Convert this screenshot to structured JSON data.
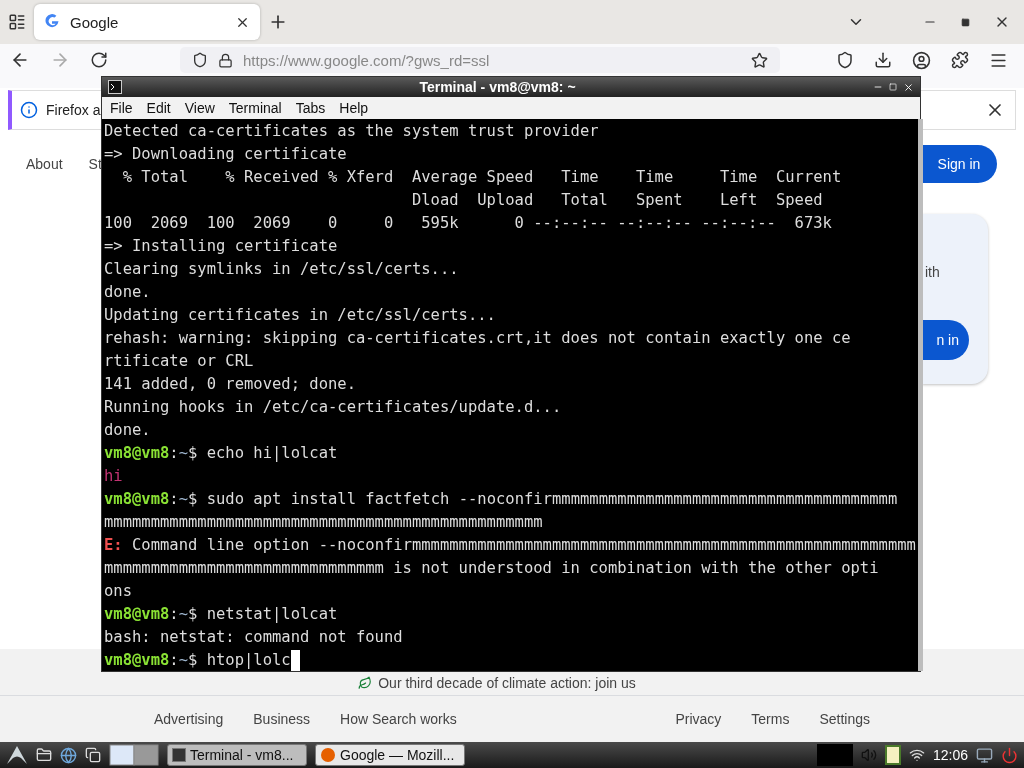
{
  "browser": {
    "tab": {
      "title": "Google",
      "selected": true
    },
    "url": "https://www.google.com/?gws_rd=ssl",
    "notification": "Firefox a",
    "header_links": [
      "About",
      "St"
    ],
    "sign_in": "Sign in",
    "card": {
      "text": "ith",
      "button": "n in"
    },
    "climate": "Our third decade of climate action: join us",
    "footer_left": [
      "Advertising",
      "Business",
      "How Search works"
    ],
    "footer_right": [
      "Privacy",
      "Terms",
      "Settings"
    ]
  },
  "terminal": {
    "title": "Terminal - vm8@vm8: ~",
    "menu": [
      "File",
      "Edit",
      "View",
      "Terminal",
      "Tabs",
      "Help"
    ],
    "lines": [
      {
        "kind": "text",
        "text": "Detected ca-certificates as the system trust provider"
      },
      {
        "kind": "text",
        "text": "=> Downloading certificate"
      },
      {
        "kind": "text",
        "text": "  % Total    % Received % Xferd  Average Speed   Time    Time     Time  Current"
      },
      {
        "kind": "text",
        "text": "                                 Dload  Upload   Total   Spent    Left  Speed"
      },
      {
        "kind": "text",
        "text": "100  2069  100  2069    0     0   595k      0 --:--:-- --:--:-- --:--:--  673k"
      },
      {
        "kind": "text",
        "text": "=> Installing certificate"
      },
      {
        "kind": "text",
        "text": "Clearing symlinks in /etc/ssl/certs..."
      },
      {
        "kind": "text",
        "text": "done."
      },
      {
        "kind": "text",
        "text": "Updating certificates in /etc/ssl/certs..."
      },
      {
        "kind": "text",
        "text": "rehash: warning: skipping ca-certificates.crt,it does not contain exactly one ce"
      },
      {
        "kind": "text",
        "text": "rtificate or CRL"
      },
      {
        "kind": "text",
        "text": "141 added, 0 removed; done."
      },
      {
        "kind": "text",
        "text": "Running hooks in /etc/ca-certificates/update.d..."
      },
      {
        "kind": "text",
        "text": "done."
      },
      {
        "kind": "prompt",
        "user": "vm8@vm8",
        "separator": ":",
        "path": "~",
        "symbol": "$",
        "command": "echo hi|lolcat"
      },
      {
        "kind": "rainbow",
        "text": "hi"
      },
      {
        "kind": "prompt",
        "user": "vm8@vm8",
        "separator": ":",
        "path": "~",
        "symbol": "$",
        "command": "sudo apt install factfetch --noconfirmmmmmmmmmmmmmmmmmmmmmmmmmmmmmmmmmmmmm"
      },
      {
        "kind": "text",
        "text": "mmmmmmmmmmmmmmmmmmmmmmmmmmmmmmmmmmmmmmmmmmmmmmm"
      },
      {
        "kind": "error",
        "label": "E:",
        "text": " Command line option --noconfirmmmmmmmmmmmmmmmmmmmmmmmmmmmmmmmmmmmmmmmmmmmmmmmmmmmmmm"
      },
      {
        "kind": "text",
        "text": "mmmmmmmmmmmmmmmmmmmmmmmmmmmmmm is not understood in combination with the other opti"
      },
      {
        "kind": "text",
        "text": "ons"
      },
      {
        "kind": "prompt",
        "user": "vm8@vm8",
        "separator": ":",
        "path": "~",
        "symbol": "$",
        "command": "netstat|lolcat"
      },
      {
        "kind": "text",
        "text": "bash: netstat: command not found"
      },
      {
        "kind": "prompt",
        "user": "vm8@vm8",
        "separator": ":",
        "path": "~",
        "symbol": "$",
        "command": "htop|lolc",
        "cursor": true
      }
    ]
  },
  "taskbar": {
    "windows": [
      {
        "label": "Terminal - vm8...",
        "selected": false
      },
      {
        "label": "Google — Mozill...",
        "selected": true
      }
    ],
    "clock": "12:06"
  }
}
